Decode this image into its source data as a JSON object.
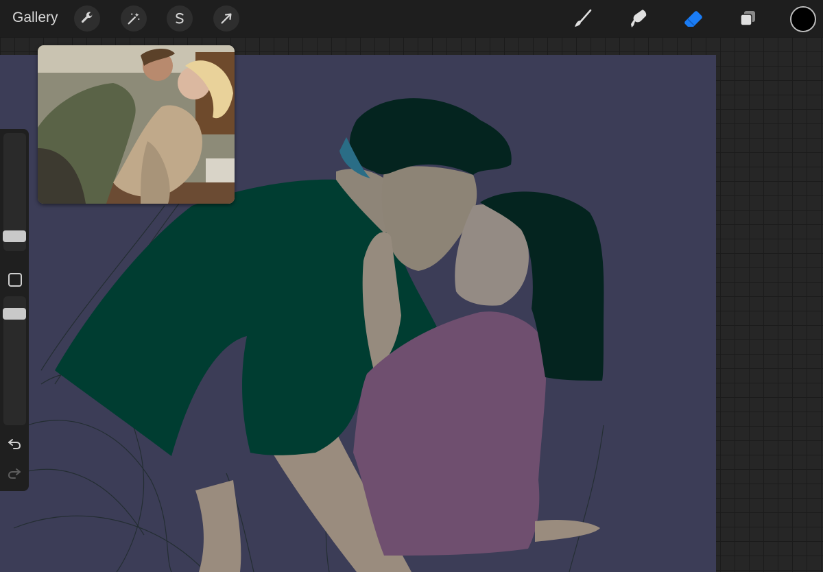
{
  "topbar": {
    "gallery_label": "Gallery",
    "left_tools": [
      {
        "name": "actions",
        "icon": "wrench-icon"
      },
      {
        "name": "adjustments",
        "icon": "magic-wand-icon"
      },
      {
        "name": "selection",
        "icon": "selection-s-icon"
      },
      {
        "name": "transform",
        "icon": "arrow-cursor-icon"
      }
    ],
    "right_tools": [
      {
        "name": "brush",
        "icon": "brush-icon"
      },
      {
        "name": "smudge",
        "icon": "smudge-icon"
      },
      {
        "name": "eraser",
        "icon": "eraser-icon",
        "active": true
      },
      {
        "name": "layers",
        "icon": "layers-icon"
      }
    ],
    "current_color": "#000000",
    "active_tool_color": "#1a7cf5"
  },
  "sidebar": {
    "brush_size_level": 0.05,
    "opacity_level": 0.95,
    "icons": [
      "modify-square-icon",
      "undo-icon",
      "redo-icon"
    ]
  },
  "canvas": {
    "background_color": "#3c3d57",
    "shirt_color": "#003d31",
    "blouse_color": "#6f4f6f",
    "hair_color": "#04241f",
    "skin_color": "#9a8c7e"
  },
  "reference": {
    "title": "",
    "content": "photo-reference-image"
  }
}
